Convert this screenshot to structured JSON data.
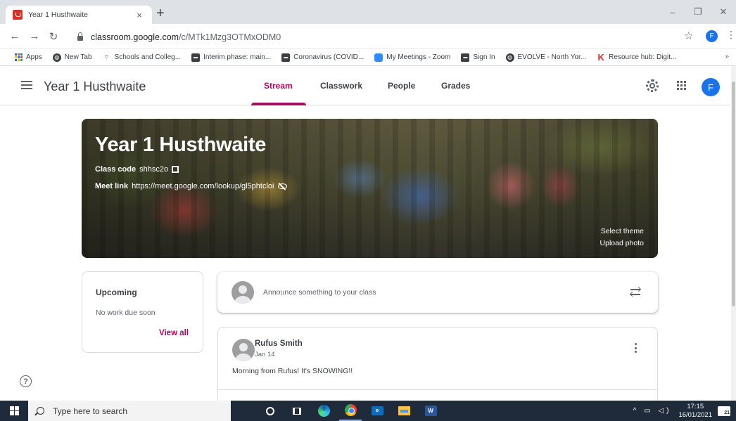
{
  "browser": {
    "tab_title": "Year 1 Husthwaite",
    "tab_close": "×",
    "new_tab": "+",
    "url_host": "classroom.google.com",
    "url_path": "/c/MTk1Mzg3OTMxODM0",
    "profile_initial": "F",
    "window_controls": [
      "–",
      "❐",
      "✕"
    ],
    "bookmarks": [
      {
        "label": "Apps",
        "icon": "apps-grid-icon"
      },
      {
        "label": "New Tab",
        "icon": "globe-icon"
      },
      {
        "label": "Schools and Colleg...",
        "icon": "wifi-icon"
      },
      {
        "label": "Interim phase: main...",
        "icon": "gov-icon"
      },
      {
        "label": "Coronavirus (COVID...",
        "icon": "gov-icon"
      },
      {
        "label": "My Meetings - Zoom",
        "icon": "zoom-icon"
      },
      {
        "label": "Sign In",
        "icon": "gov-icon"
      },
      {
        "label": "EVOLVE - North Yor...",
        "icon": "globe-icon"
      },
      {
        "label": "Resource hub: Digit...",
        "icon": "k-icon"
      }
    ],
    "bookmarks_more": "»"
  },
  "header": {
    "class_name": "Year 1 Husthwaite",
    "tabs": [
      {
        "label": "Stream",
        "active": true
      },
      {
        "label": "Classwork",
        "active": false
      },
      {
        "label": "People",
        "active": false
      },
      {
        "label": "Grades",
        "active": false
      }
    ],
    "avatar_initial": "F",
    "accent_color": "#a50e5e"
  },
  "banner": {
    "title": "Year 1 Husthwaite",
    "class_code_label": "Class code",
    "class_code": "shhsc2o",
    "meet_link_label": "Meet link",
    "meet_link": "https://meet.google.com/lookup/gl5phtcloi",
    "select_theme": "Select theme",
    "upload_photo": "Upload photo"
  },
  "upcoming": {
    "title": "Upcoming",
    "empty_text": "No work due soon",
    "view_all": "View all"
  },
  "announce": {
    "placeholder": "Announce something to your class"
  },
  "post": {
    "author": "Rufus Smith",
    "date": "Jan 14",
    "body": "Morning from Rufus! It's SNOWING!!"
  },
  "taskbar": {
    "search_placeholder": "Type here to search",
    "time": "17:15",
    "date": "16/01/2021",
    "notification_count": "21"
  }
}
